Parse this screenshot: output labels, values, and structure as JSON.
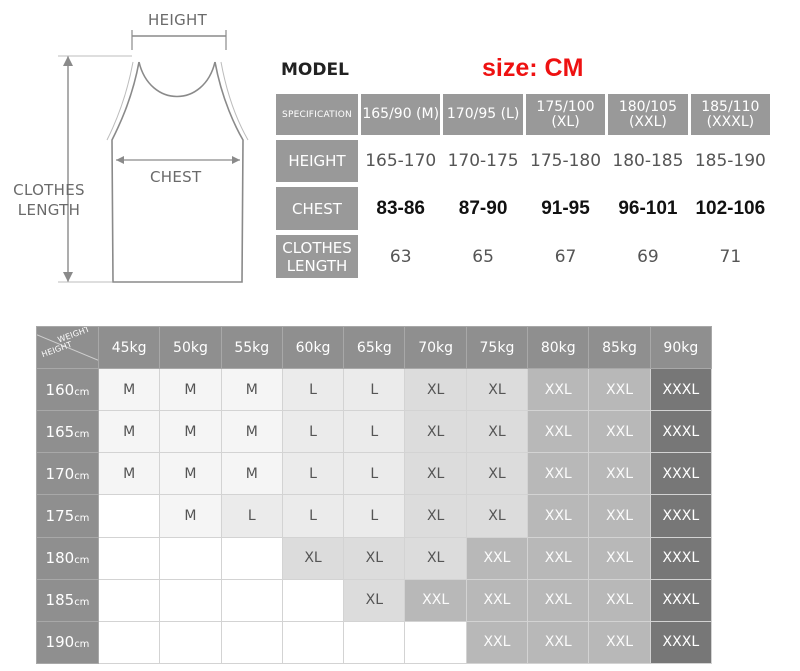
{
  "illustration": {
    "height_label": "HEIGHT",
    "chest_label": "CHEST",
    "length_label": "CLOTHES LENGTH"
  },
  "spec": {
    "model_label": "MODEL",
    "unit_label": "size: CM",
    "rows": [
      {
        "head": "SPECIFICATION",
        "values": [
          "165/90 (M)",
          "170/95 (L)",
          "175/100 (XL)",
          "180/105 (XXL)",
          "185/110 (XXXL)"
        ]
      },
      {
        "head": "HEIGHT",
        "values": [
          "165-170",
          "170-175",
          "175-180",
          "180-185",
          "185-190"
        ]
      },
      {
        "head": "CHEST",
        "values": [
          "83-86",
          "87-90",
          "91-95",
          "96-101",
          "102-106"
        ]
      },
      {
        "head": "CLOTHES LENGTH",
        "values": [
          "63",
          "65",
          "67",
          "69",
          "71"
        ]
      }
    ]
  },
  "chart": {
    "corner_weight": "WEIGHT",
    "corner_height": "HEIGHT",
    "weights": [
      "45kg",
      "50kg",
      "55kg",
      "60kg",
      "65kg",
      "70kg",
      "75kg",
      "80kg",
      "85kg",
      "90kg"
    ],
    "rows": [
      {
        "height": "160",
        "unit": "cm",
        "sizes": [
          "M",
          "M",
          "M",
          "L",
          "L",
          "XL",
          "XL",
          "XXL",
          "XXL",
          "XXXL"
        ]
      },
      {
        "height": "165",
        "unit": "cm",
        "sizes": [
          "M",
          "M",
          "M",
          "L",
          "L",
          "XL",
          "XL",
          "XXL",
          "XXL",
          "XXXL"
        ]
      },
      {
        "height": "170",
        "unit": "cm",
        "sizes": [
          "M",
          "M",
          "M",
          "L",
          "L",
          "XL",
          "XL",
          "XXL",
          "XXL",
          "XXXL"
        ]
      },
      {
        "height": "175",
        "unit": "cm",
        "sizes": [
          "",
          "M",
          "L",
          "L",
          "L",
          "XL",
          "XL",
          "XXL",
          "XXL",
          "XXXL"
        ]
      },
      {
        "height": "180",
        "unit": "cm",
        "sizes": [
          "",
          "",
          "",
          "XL",
          "XL",
          "XL",
          "XXL",
          "XXL",
          "XXL",
          "XXXL"
        ]
      },
      {
        "height": "185",
        "unit": "cm",
        "sizes": [
          "",
          "",
          "",
          "",
          "XL",
          "XXL",
          "XXL",
          "XXL",
          "XXL",
          "XXXL"
        ]
      },
      {
        "height": "190",
        "unit": "cm",
        "sizes": [
          "",
          "",
          "",
          "",
          "",
          "",
          "XXL",
          "XXL",
          "XXL",
          "XXXL"
        ]
      }
    ]
  },
  "colors": {
    "header_gray": "#999999",
    "unit_red": "#ee1111",
    "size_M": "#f5f5f5",
    "size_L": "#ebebeb",
    "size_XL": "#dcdcdc",
    "size_XXL": "#b8b8b8",
    "size_XXXL": "#777777"
  }
}
